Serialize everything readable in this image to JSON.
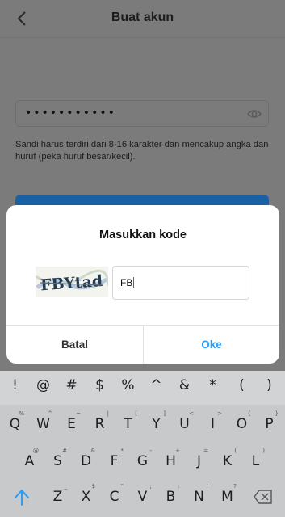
{
  "header": {
    "title": "Buat akun"
  },
  "password": {
    "masked": "•••••••••••"
  },
  "hint": "Sandi harus terdiri dari 8-16 karakter dan mencakup angka dan huruf (peka huruf besar/kecil).",
  "dialog": {
    "title": "Masukkan kode",
    "captcha_text": "FBYtad",
    "input_value": "FB",
    "cancel_label": "Batal",
    "ok_label": "Oke"
  },
  "colors": {
    "accent": "#2a9df4",
    "primary_button": "#1a60a5",
    "backdrop": "#7b7b7b"
  },
  "keyboard": {
    "symbols": [
      "!",
      "@",
      "#",
      "$",
      "%",
      "^",
      "&",
      "*",
      "(",
      ")"
    ],
    "rows": [
      {
        "keys": [
          "Q",
          "W",
          "E",
          "R",
          "T",
          "Y",
          "U",
          "I",
          "O",
          "P"
        ],
        "subs": [
          "%",
          "^",
          "~",
          "|",
          "[",
          "]",
          "<",
          ">",
          "{",
          "}"
        ]
      },
      {
        "keys": [
          "A",
          "S",
          "D",
          "F",
          "G",
          "H",
          "J",
          "K",
          "L"
        ],
        "subs": [
          "@",
          "#",
          "&",
          "*",
          "-",
          "+",
          "=",
          "(",
          ")"
        ]
      },
      {
        "keys": [
          "Z",
          "X",
          "C",
          "V",
          "B",
          "N",
          "M"
        ],
        "subs": [
          "_",
          "$",
          "\"",
          ";",
          ":",
          "!",
          "?"
        ]
      }
    ],
    "shift_icon": "shift-arrow-icon",
    "backspace_icon": "backspace-icon"
  }
}
